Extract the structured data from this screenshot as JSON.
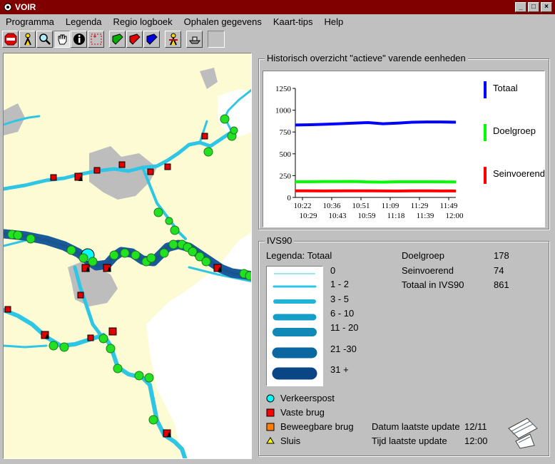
{
  "window": {
    "title": "VOIR",
    "buttons": [
      "_",
      "□",
      "×"
    ]
  },
  "menu": [
    "Programma",
    "Legenda",
    "Regio logboek",
    "Ophalen gegevens",
    "Kaart-tips",
    "Help"
  ],
  "toolbar": [
    "stop-icon",
    "worker-icon",
    "magnifier-icon",
    "hand-icon",
    "info-icon",
    "zoom-box-icon",
    "green-book-icon",
    "red-book-icon",
    "blue-book-icon",
    "worker-alt-icon",
    "ship-icon"
  ],
  "chart_panel": {
    "title": "Historisch overzicht \"actieve\" varende eenheden"
  },
  "chart_data": {
    "type": "line",
    "x_ticks_top": [
      "10:22",
      "10:36",
      "10:51",
      "11:09",
      "11:29",
      "11:49"
    ],
    "x_ticks_bottom": [
      "10:29",
      "10:43",
      "10:59",
      "11:18",
      "11:39",
      "12:00"
    ],
    "y_ticks": [
      "1250",
      "1000",
      "750",
      "500",
      "250",
      "0"
    ],
    "ylim": [
      0,
      1250
    ],
    "x": [
      0,
      1,
      2,
      3,
      4,
      5,
      6,
      7,
      8,
      9,
      10,
      11
    ],
    "series": [
      {
        "name": "Totaal",
        "color": "#0000ff",
        "values": [
          830,
          833,
          838,
          845,
          852,
          858,
          845,
          852,
          862,
          865,
          865,
          862
        ]
      },
      {
        "name": "Doelgroep",
        "color": "#00ff00",
        "values": [
          180,
          180,
          182,
          182,
          183,
          178,
          176,
          180,
          180,
          180,
          179,
          178
        ]
      },
      {
        "name": "Seinvoerend",
        "color": "#ff0000",
        "values": [
          76,
          76,
          75,
          76,
          76,
          76,
          75,
          74,
          76,
          76,
          75,
          74
        ]
      }
    ],
    "legend_position": "right"
  },
  "ivs": {
    "title": "IVS90",
    "legend_title": "Legenda: Totaal",
    "thickness_labels": [
      "0",
      "1 - 2",
      "3 - 5",
      "6 - 10",
      "11 - 20",
      "21 -30",
      "31 +"
    ],
    "stats": [
      {
        "label": "Doelgroep",
        "value": "178"
      },
      {
        "label": "Seinvoerend",
        "value": "74"
      },
      {
        "label": "Totaal in IVS90",
        "value": "861"
      }
    ],
    "symbols": [
      {
        "label": "Verkeerspost",
        "color": "#00ffff"
      },
      {
        "label": "Vaste brug",
        "color": "#ff0000"
      },
      {
        "label": "Beweegbare brug",
        "color": "#ff8000"
      },
      {
        "label": "Sluis",
        "color": "#ffff00"
      }
    ],
    "update_date_label": "Datum laatste update",
    "update_date": "12/11",
    "update_time_label": "Tijd laatste update",
    "update_time": "12:00"
  }
}
